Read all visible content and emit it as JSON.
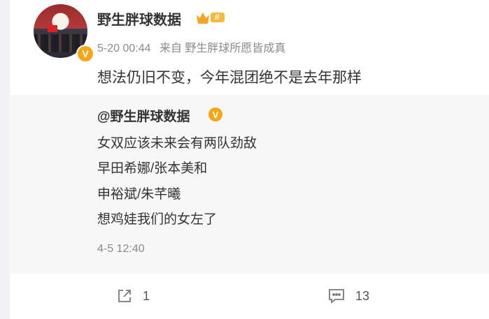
{
  "post": {
    "username": "野生胖球数据",
    "level_badge": "II",
    "timestamp": "5-20 00:44",
    "source": "来自 野生胖球所愿皆成真",
    "text": "想法仍旧不变，今年混团绝不是去年那样"
  },
  "repost": {
    "author": "@野生胖球数据",
    "lines": [
      "女双应该未来会有两队劲敌",
      "早田希娜/张本美和",
      "申裕斌/朱芊曦",
      "想鸡娃我们的女左了"
    ],
    "timestamp": "4-5 12:40"
  },
  "actions": {
    "share_count": "1",
    "comment_count": "13"
  },
  "colors": {
    "verified": "#f7a618",
    "repost_bg": "#f7f7f7",
    "meta_text": "#8a8a8a"
  },
  "icons": [
    "verified-icon",
    "level-crown-icon",
    "share-icon",
    "comment-icon"
  ]
}
